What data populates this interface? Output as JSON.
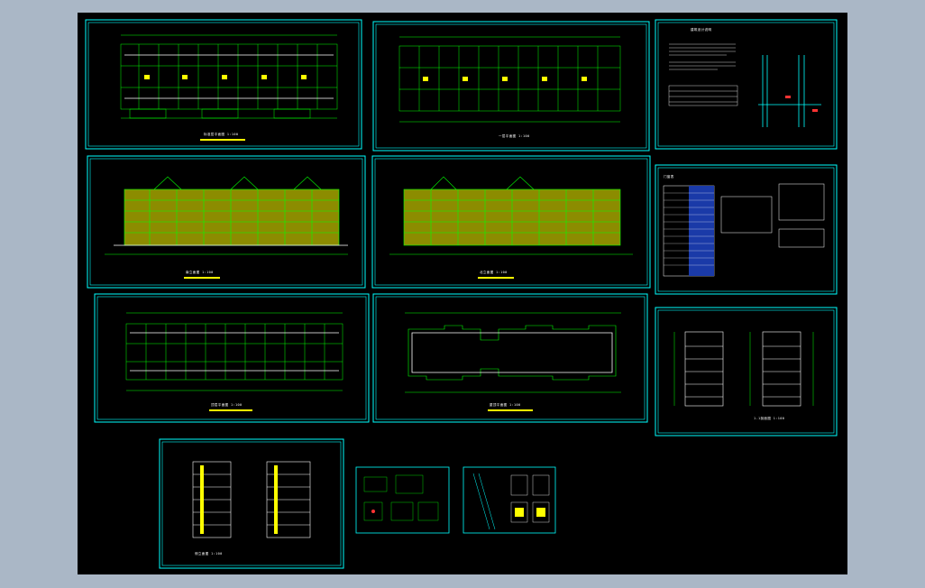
{
  "colors": {
    "background": "#aab7c6",
    "canvas": "#000000",
    "frame": "#00ffff",
    "linework": "#00ff00",
    "highlight": "#ffff00",
    "dim": "#00ff66",
    "walls": "#ffffff"
  },
  "sheets": [
    {
      "id": "floor-plan-1",
      "title": "标准层平面图  1:100"
    },
    {
      "id": "floor-plan-2",
      "title": "一层平面图  1:100"
    },
    {
      "id": "detail-notes",
      "title": "建筑设计说明"
    },
    {
      "id": "elevation-south",
      "title": "南立面图  1:100"
    },
    {
      "id": "elevation-north",
      "title": "北立面图  1:100"
    },
    {
      "id": "door-window-schedule",
      "title": "门窗表"
    },
    {
      "id": "floor-plan-3",
      "title": "顶层平面图  1:100"
    },
    {
      "id": "roof-plan",
      "title": "屋顶平面图  1:100"
    },
    {
      "id": "section-1",
      "title": "1-1剖面图  1:100"
    },
    {
      "id": "side-elevations",
      "title": "侧立面图  1:100"
    },
    {
      "id": "details-a",
      "title": "节点详图"
    },
    {
      "id": "details-b",
      "title": "楼梯详图"
    }
  ]
}
